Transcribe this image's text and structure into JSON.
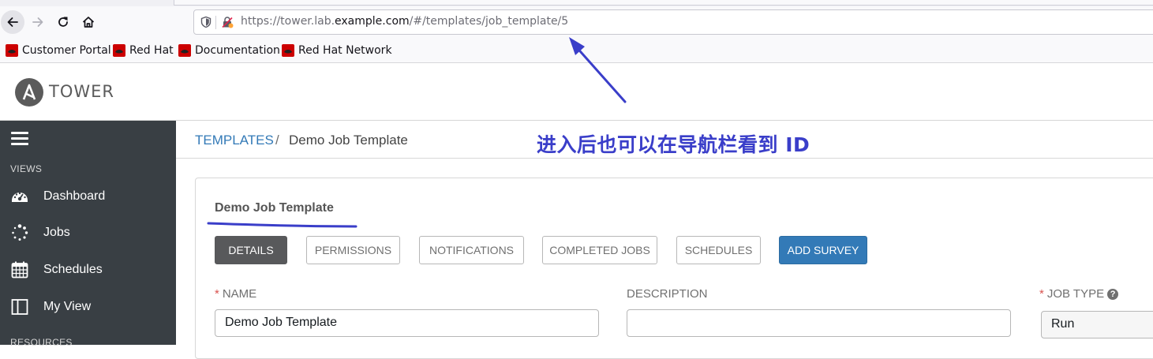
{
  "browser": {
    "url_prefix": "https://tower.lab.",
    "url_host": "example.com",
    "url_path": "/#/templates/job_template/5",
    "bookmarks": [
      "Customer Portal",
      "Red Hat",
      "Documentation",
      "Red Hat Network"
    ]
  },
  "app": {
    "logo_text": "TOWER"
  },
  "sidebar": {
    "section_views": "VIEWS",
    "items": [
      {
        "label": "Dashboard",
        "icon": "dashboard-icon"
      },
      {
        "label": "Jobs",
        "icon": "jobs-spinner-icon"
      },
      {
        "label": "Schedules",
        "icon": "calendar-icon"
      },
      {
        "label": "My View",
        "icon": "columns-icon"
      }
    ],
    "section_resources": "RESOURCES"
  },
  "breadcrumb": {
    "link": "TEMPLATES",
    "separator": "/",
    "current": "Demo Job Template"
  },
  "annotation": {
    "text": "进入后也可以在导航栏看到 ID",
    "color": "#3a3ec9"
  },
  "panel": {
    "title": "Demo Job Template",
    "tabs": [
      "DETAILS",
      "PERMISSIONS",
      "NOTIFICATIONS",
      "COMPLETED JOBS",
      "SCHEDULES",
      "ADD SURVEY"
    ],
    "active_tab": "DETAILS"
  },
  "form": {
    "name_label": "NAME",
    "name_value": "Demo Job Template",
    "description_label": "DESCRIPTION",
    "description_value": "",
    "job_type_label": "JOB TYPE",
    "job_type_value": "Run",
    "required_marker": "*"
  },
  "colors": {
    "sidebar_bg": "#393f44",
    "link": "#337ab7",
    "primary_button": "#337ab7",
    "active_tab": "#58595b"
  }
}
